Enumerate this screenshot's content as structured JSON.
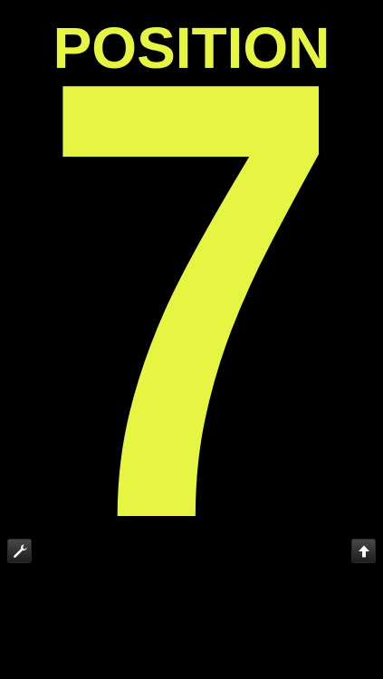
{
  "header": {
    "title": "POSITION"
  },
  "display": {
    "position_number": "7",
    "text_color": "#e6f542",
    "background_color": "#000000"
  },
  "toolbar": {
    "settings_icon": "wrench-icon",
    "share_icon": "arrow-up-icon"
  }
}
